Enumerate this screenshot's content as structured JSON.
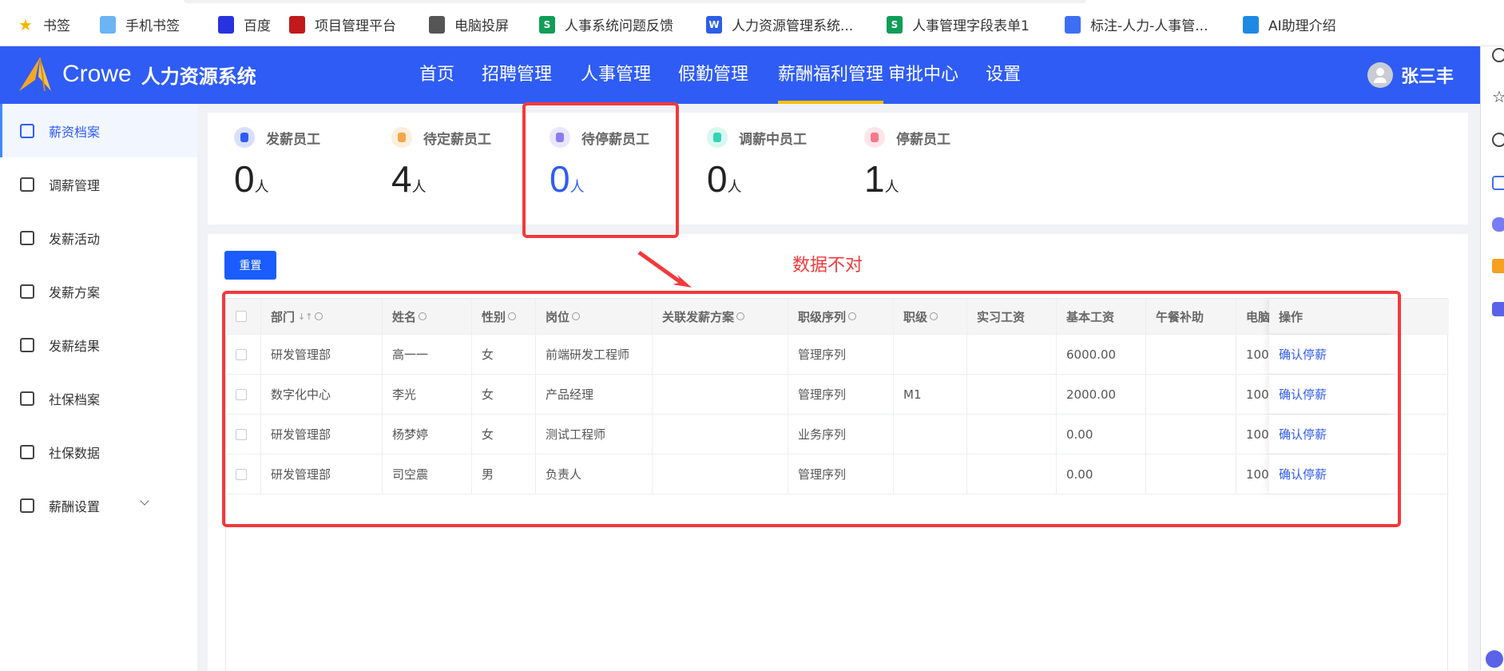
{
  "bookmarks": [
    {
      "label": "书签",
      "icon": "star-icon",
      "color": "#f5b800"
    },
    {
      "label": "手机书签",
      "icon": "phone-icon",
      "color": "#6bb4f5"
    },
    {
      "label": "百度",
      "icon": "baidu-paw-icon",
      "color": "#2932e1"
    },
    {
      "label": "项目管理平台",
      "icon": "redmine-icon",
      "color": "#c21a1a"
    },
    {
      "label": "电脑投屏",
      "icon": "cast-icon",
      "color": "#555555"
    },
    {
      "label": "人事系统问题反馈",
      "icon": "sheet-icon",
      "color": "#0f9d58"
    },
    {
      "label": "人力资源管理系统...",
      "icon": "word-doc-icon",
      "color": "#2b5ee8"
    },
    {
      "label": "人事管理字段表单1",
      "icon": "sheet-icon",
      "color": "#0f9d58"
    },
    {
      "label": "标注-人力-人事管...",
      "icon": "monster-icon",
      "color": "#3d6ff5"
    },
    {
      "label": "AI助理介绍",
      "icon": "doc-icon",
      "color": "#1e88e5"
    }
  ],
  "header": {
    "brand": "Crowe",
    "system": "人力资源系统",
    "nav": [
      "首页",
      "招聘管理",
      "人事管理",
      "假勤管理",
      "薪酬福利管理",
      "审批中心",
      "设置"
    ],
    "active_nav": "薪酬福利管理",
    "user": "张三丰",
    "colors": {
      "bar": "#2f5cf5",
      "active_underline": "#f7c000"
    }
  },
  "sidebar": {
    "items": [
      {
        "label": "薪资档案",
        "active": true
      },
      {
        "label": "调薪管理"
      },
      {
        "label": "发薪活动"
      },
      {
        "label": "发薪方案"
      },
      {
        "label": "发薪结果"
      },
      {
        "label": "社保档案"
      },
      {
        "label": "社保数据"
      },
      {
        "label": "薪酬设置",
        "expandable": true
      }
    ]
  },
  "stats": [
    {
      "label": "发薪员工",
      "value": "0",
      "unit": "人",
      "color": "#2f5cf5"
    },
    {
      "label": "待定薪员工",
      "value": "4",
      "unit": "人",
      "color": "#f5a64a"
    },
    {
      "label": "待停薪员工",
      "value": "0",
      "unit": "人",
      "color": "#8a7cf5"
    },
    {
      "label": "调薪中员工",
      "value": "0",
      "unit": "人",
      "color": "#33d3b5"
    },
    {
      "label": "停薪员工",
      "value": "1",
      "unit": "人",
      "color": "#f57a8a"
    }
  ],
  "toolbar": {
    "reset": "重置"
  },
  "annotation": {
    "note": "数据不对",
    "color": "#f2393b"
  },
  "table": {
    "columns": [
      "部门",
      "姓名",
      "性别",
      "岗位",
      "关联发薪方案",
      "职级序列",
      "职级",
      "实习工资",
      "基本工资",
      "午餐补助",
      "电脑",
      "操作"
    ],
    "sort_glyph": "↓↑",
    "rows": [
      [
        "研发管理部",
        "高一一",
        "女",
        "前端研发工程师",
        "",
        "管理序列",
        "",
        "",
        "6000.00",
        "",
        "100",
        "确认停薪"
      ],
      [
        "数字化中心",
        "李光",
        "女",
        "产品经理",
        "",
        "管理序列",
        "M1",
        "",
        "2000.00",
        "",
        "100",
        "确认停薪"
      ],
      [
        "研发管理部",
        "杨梦婷",
        "女",
        "测试工程师",
        "",
        "业务序列",
        "",
        "",
        "0.00",
        "",
        "100",
        "确认停薪"
      ],
      [
        "研发管理部",
        "司空震",
        "男",
        "负责人",
        "",
        "管理序列",
        "",
        "",
        "0.00",
        "",
        "100",
        "确认停薪"
      ]
    ]
  }
}
